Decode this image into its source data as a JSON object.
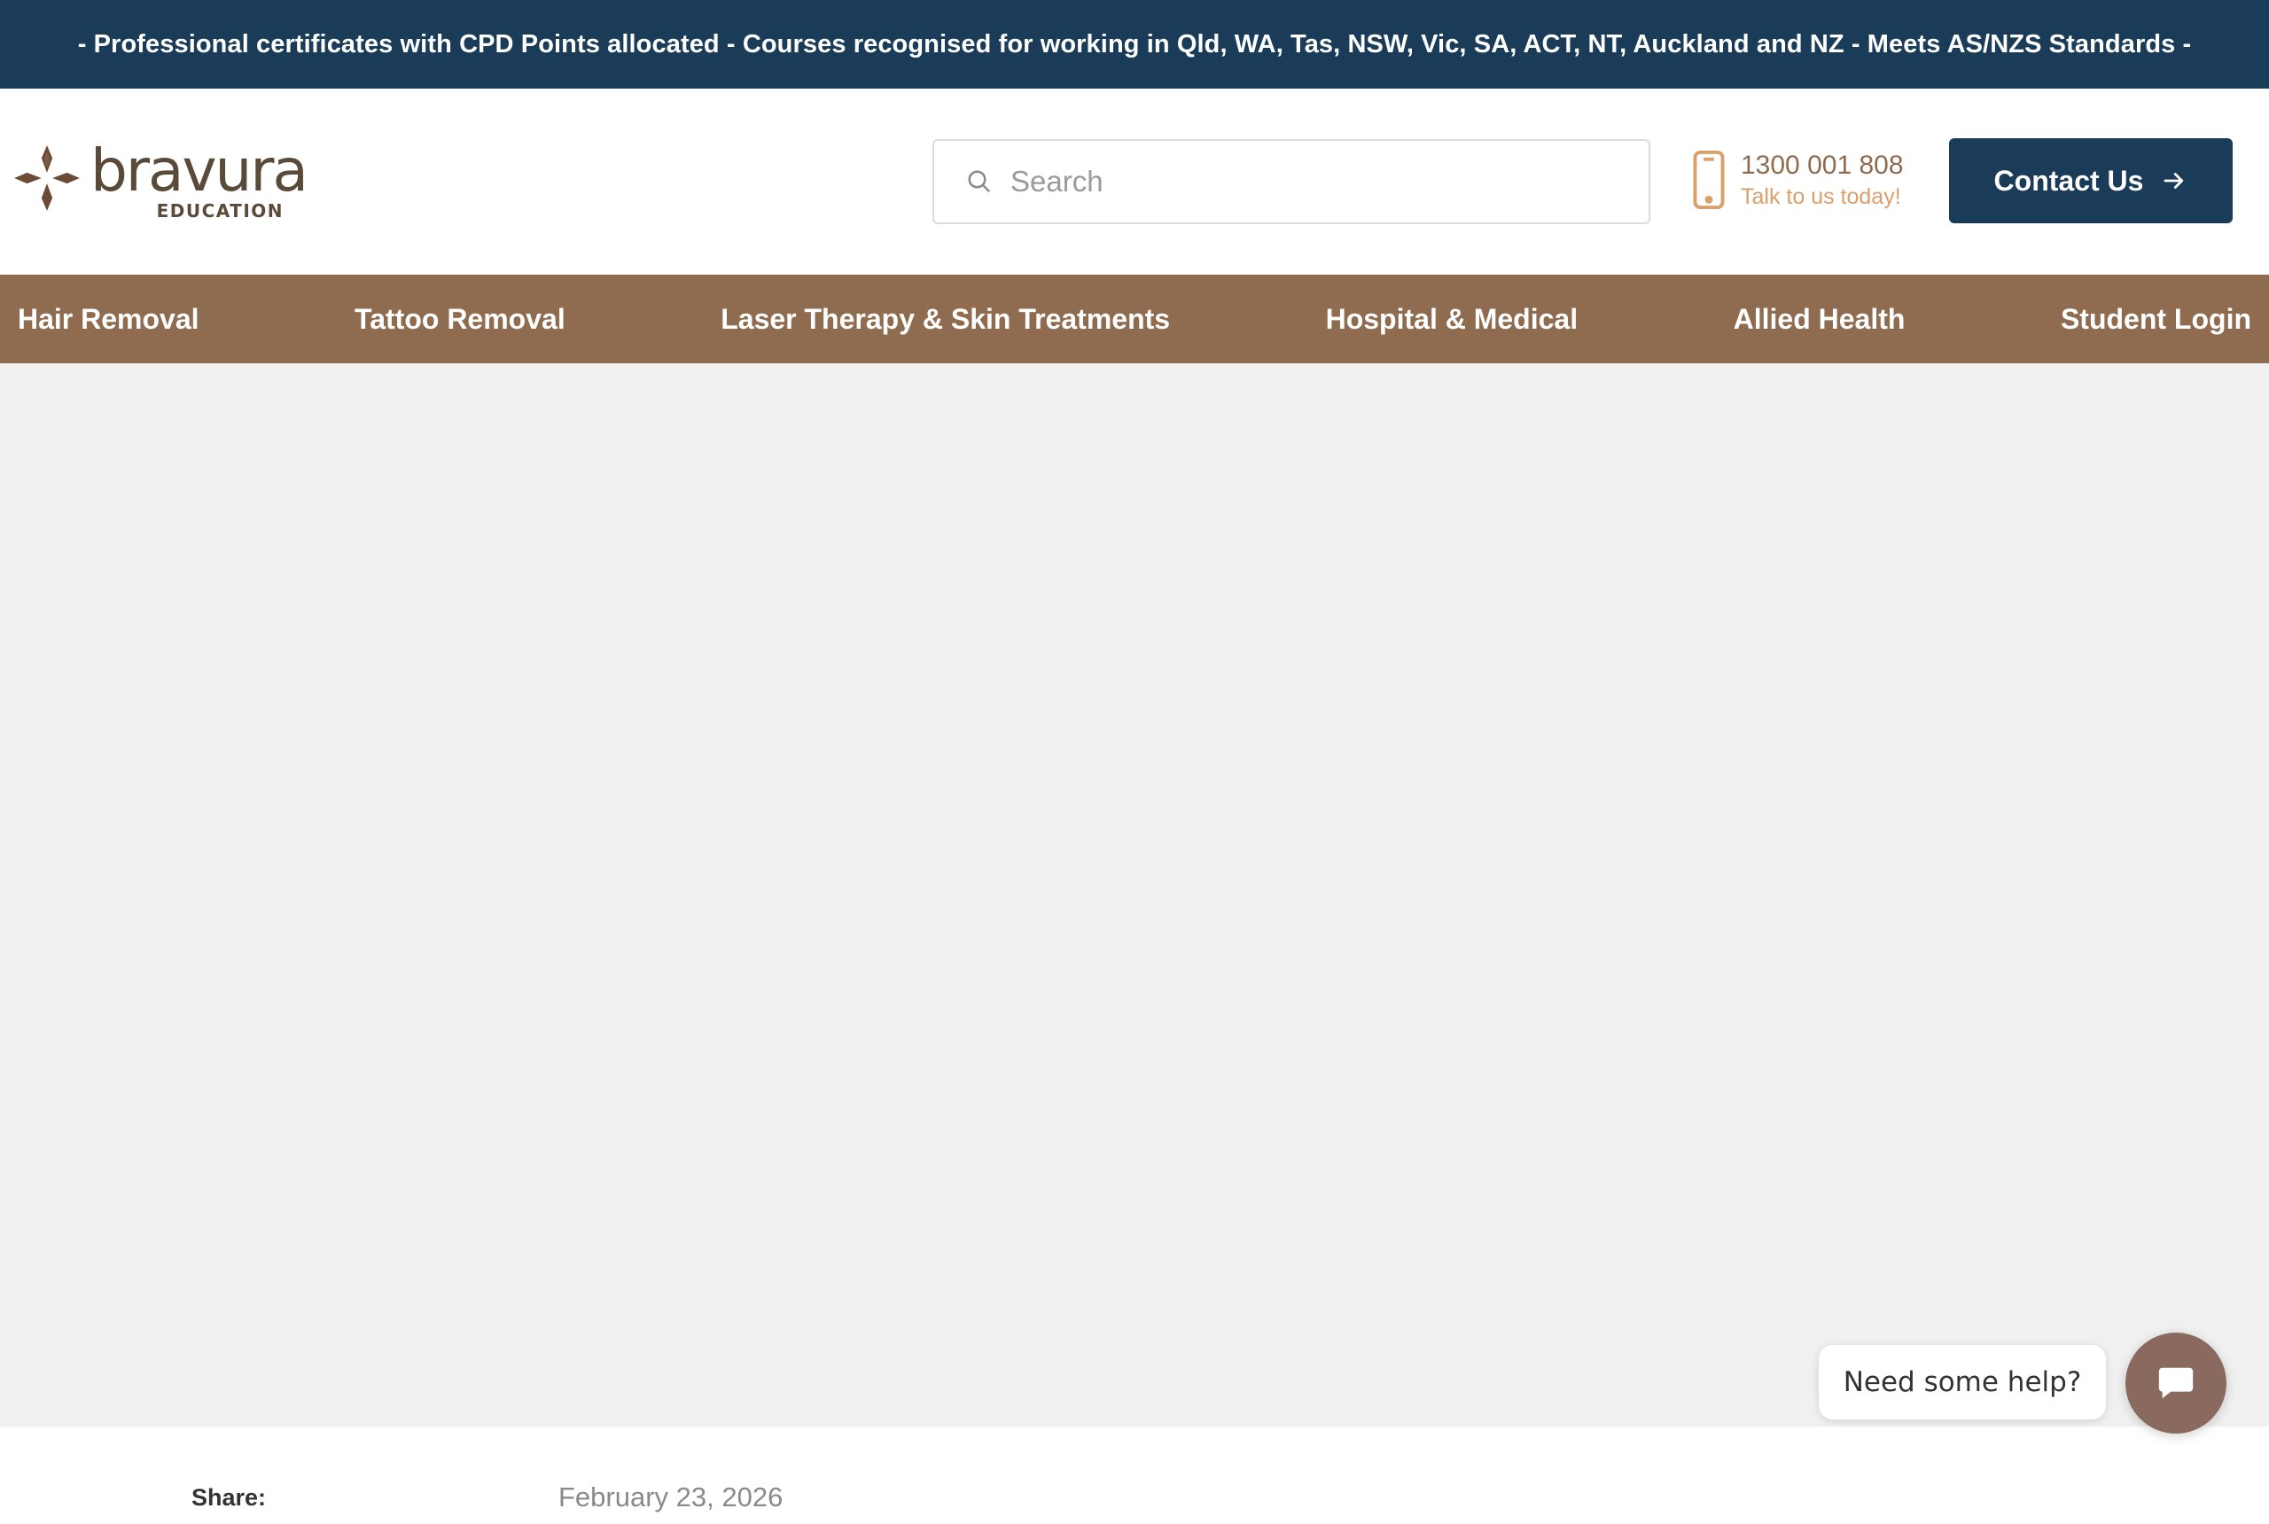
{
  "announcement": "- Professional certificates with CPD Points allocated - Courses recognised for working in Qld, WA, Tas, NSW, Vic, SA, ACT, NT, Auckland and NZ - Meets AS/NZS Standards -",
  "logo": {
    "word": "bravura",
    "sub": "EDUCATION",
    "icon": "bravura-logo-mark"
  },
  "search": {
    "placeholder": "Search",
    "value": "",
    "icon": "search-icon"
  },
  "phone": {
    "number": "1300 001 808",
    "tagline": "Talk to us today!",
    "icon": "mobile-phone-icon"
  },
  "contact_button": {
    "label": "Contact Us",
    "icon": "arrow-right-icon"
  },
  "nav": {
    "items": [
      {
        "label": "Hair Removal"
      },
      {
        "label": "Tattoo Removal"
      },
      {
        "label": "Laser Therapy & Skin Treatments"
      },
      {
        "label": "Hospital & Medical"
      },
      {
        "label": "Allied Health"
      },
      {
        "label": "Student Login"
      }
    ]
  },
  "post": {
    "share_label": "Share:",
    "date": "February 23, 2026"
  },
  "help_widget": {
    "text": "Need some help?",
    "icon": "chat-bubble-icon"
  },
  "colors": {
    "navy": "#1a3c58",
    "brown": "#8f6c4f",
    "tan": "#d9a06b",
    "hero_bg": "#f0f0f0",
    "chat_btn": "#8a6a5e"
  }
}
